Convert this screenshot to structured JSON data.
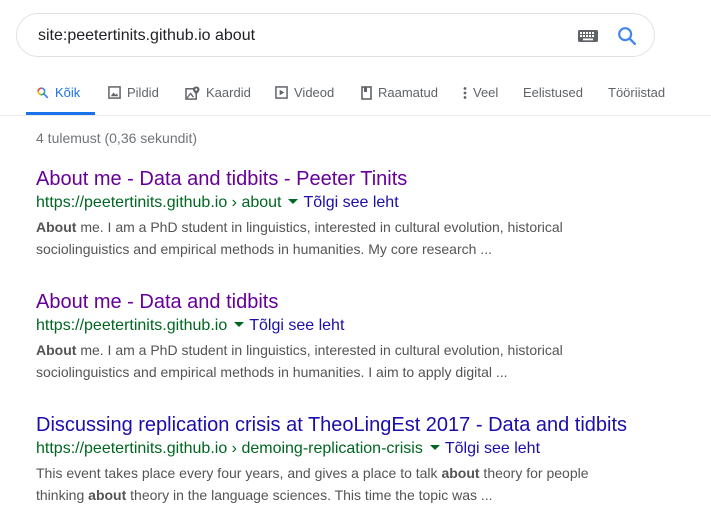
{
  "search": {
    "query": "site:peetertinits.github.io about"
  },
  "tabs": [
    {
      "label": "Kõik",
      "icon": "search-icon",
      "active": true
    },
    {
      "label": "Pildid",
      "icon": "image-icon"
    },
    {
      "label": "Kaardid",
      "icon": "map-icon"
    },
    {
      "label": "Videod",
      "icon": "video-icon"
    },
    {
      "label": "Raamatud",
      "icon": "book-icon"
    },
    {
      "label": "Veel",
      "icon": "more-vert-icon"
    },
    {
      "label": "Eelistused"
    },
    {
      "label": "Tööriistad"
    }
  ],
  "stats": "4 tulemust (0,36 sekundit)",
  "results": [
    {
      "title": "About me - Data and tidbits - Peeter Tinits",
      "url": "https://peetertinits.github.io › about",
      "translate": "Tõlgi see leht",
      "snippet_line1": [
        {
          "text": "About",
          "bold": true
        },
        {
          "text": " me. I am a PhD student in linguistics, interested in cultural evolution, historical",
          "bold": false
        }
      ],
      "snippet_line2": [
        {
          "text": "sociolinguistics and empirical methods in humanities. My core research ...",
          "bold": false
        }
      ]
    },
    {
      "title": "About me - Data and tidbits",
      "url": "https://peetertinits.github.io",
      "translate": "Tõlgi see leht",
      "snippet_line1": [
        {
          "text": "About",
          "bold": true
        },
        {
          "text": " me. I am a PhD student in linguistics, interested in cultural evolution, historical",
          "bold": false
        }
      ],
      "snippet_line2": [
        {
          "text": "sociolinguistics and empirical methods in humanities. I aim to apply digital ...",
          "bold": false
        }
      ]
    },
    {
      "title": "Discussing replication crisis at TheoLingEst 2017 - Data and tidbits",
      "url": "https://peetertinits.github.io › demoing-replication-crisis",
      "translate": "Tõlgi see leht",
      "snippet_line1": [
        {
          "text": "This event takes place every four years, and gives a place to talk ",
          "bold": false
        },
        {
          "text": "about",
          "bold": true
        },
        {
          "text": " theory for people",
          "bold": false
        }
      ],
      "snippet_line2": [
        {
          "text": "thinking ",
          "bold": false
        },
        {
          "text": "about",
          "bold": true
        },
        {
          "text": " theory in the language sciences. This time the topic was ...",
          "bold": false
        }
      ]
    }
  ],
  "colors": {
    "accent": "#1a73e8",
    "visited_link": "#660099",
    "link": "#1a0dab",
    "url_green": "#006621",
    "snippet": "#545454"
  }
}
